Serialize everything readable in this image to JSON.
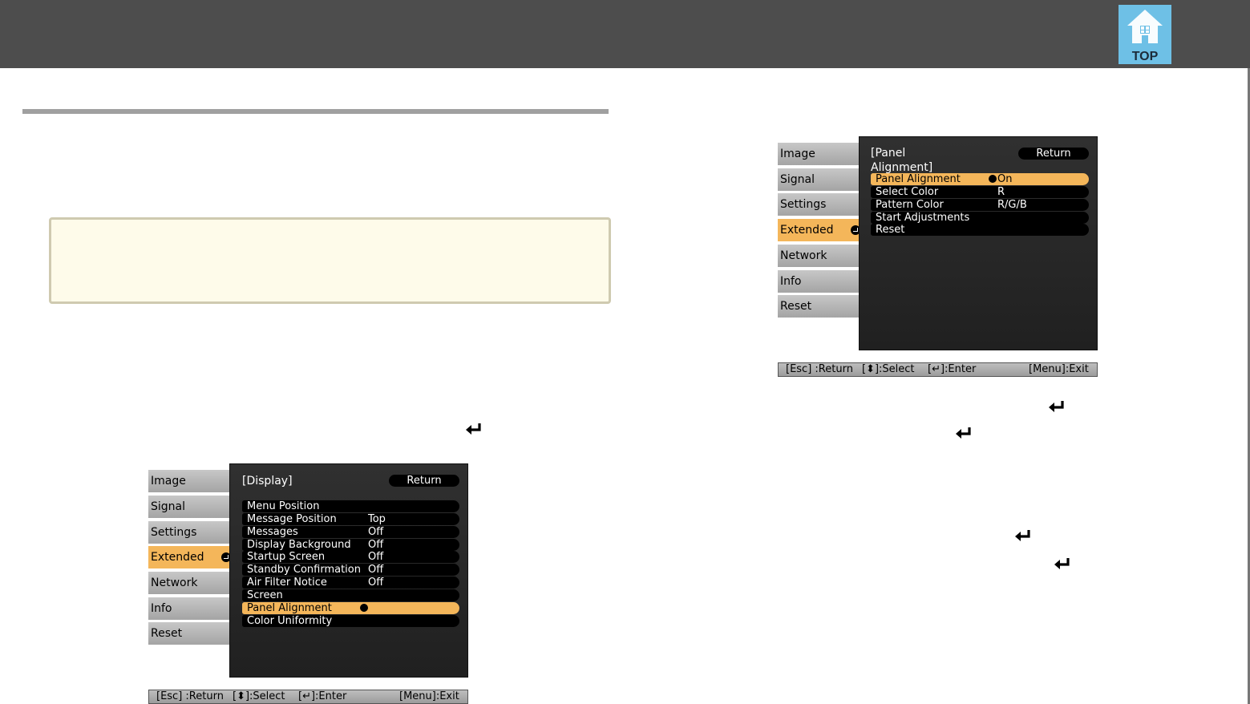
{
  "header": {
    "top_button_label": "TOP"
  },
  "menu1": {
    "tabs": [
      "Image",
      "Signal",
      "Settings",
      "Extended",
      "Network",
      "Info",
      "Reset"
    ],
    "active_tab_index": 3,
    "panel_title": "[Display]",
    "return_label": "Return",
    "rows": [
      {
        "label": "Menu Position",
        "value": ""
      },
      {
        "label": "Message Position",
        "value": "Top"
      },
      {
        "label": "Messages",
        "value": "Off"
      },
      {
        "label": "Display Background",
        "value": "Off"
      },
      {
        "label": "Startup Screen",
        "value": "Off"
      },
      {
        "label": "Standby Confirmation",
        "value": "Off"
      },
      {
        "label": "Air Filter Notice",
        "value": "Off"
      },
      {
        "label": "Screen",
        "value": ""
      },
      {
        "label": "Panel Alignment",
        "value": ""
      },
      {
        "label": "Color Uniformity",
        "value": ""
      }
    ],
    "highlight_row_index": 8,
    "footer": {
      "esc": "[Esc] :Return",
      "select": "[⬍]:Select",
      "enter": "[↵]:Enter",
      "menu": "[Menu]:Exit"
    }
  },
  "menu2": {
    "tabs": [
      "Image",
      "Signal",
      "Settings",
      "Extended",
      "Network",
      "Info",
      "Reset"
    ],
    "active_tab_index": 3,
    "panel_title": "[Panel Alignment]",
    "return_label": "Return",
    "rows": [
      {
        "label": "Panel Alignment",
        "value": "On"
      },
      {
        "label": "Select Color",
        "value": "R"
      },
      {
        "label": "Pattern Color",
        "value": "R/G/B"
      },
      {
        "label": "Start Adjustments",
        "value": ""
      },
      {
        "label": "Reset",
        "value": ""
      }
    ],
    "highlight_row_index": 0,
    "footer": {
      "esc": "[Esc] :Return",
      "select": "[⬍]:Select",
      "enter": "[↵]:Enter",
      "menu": "[Menu]:Exit"
    }
  },
  "colors": {
    "header_bg": "#4d4d4d",
    "highlight": "#f4b65a",
    "note_bg": "#fefbea",
    "top_icon": "#6ec0e6"
  }
}
